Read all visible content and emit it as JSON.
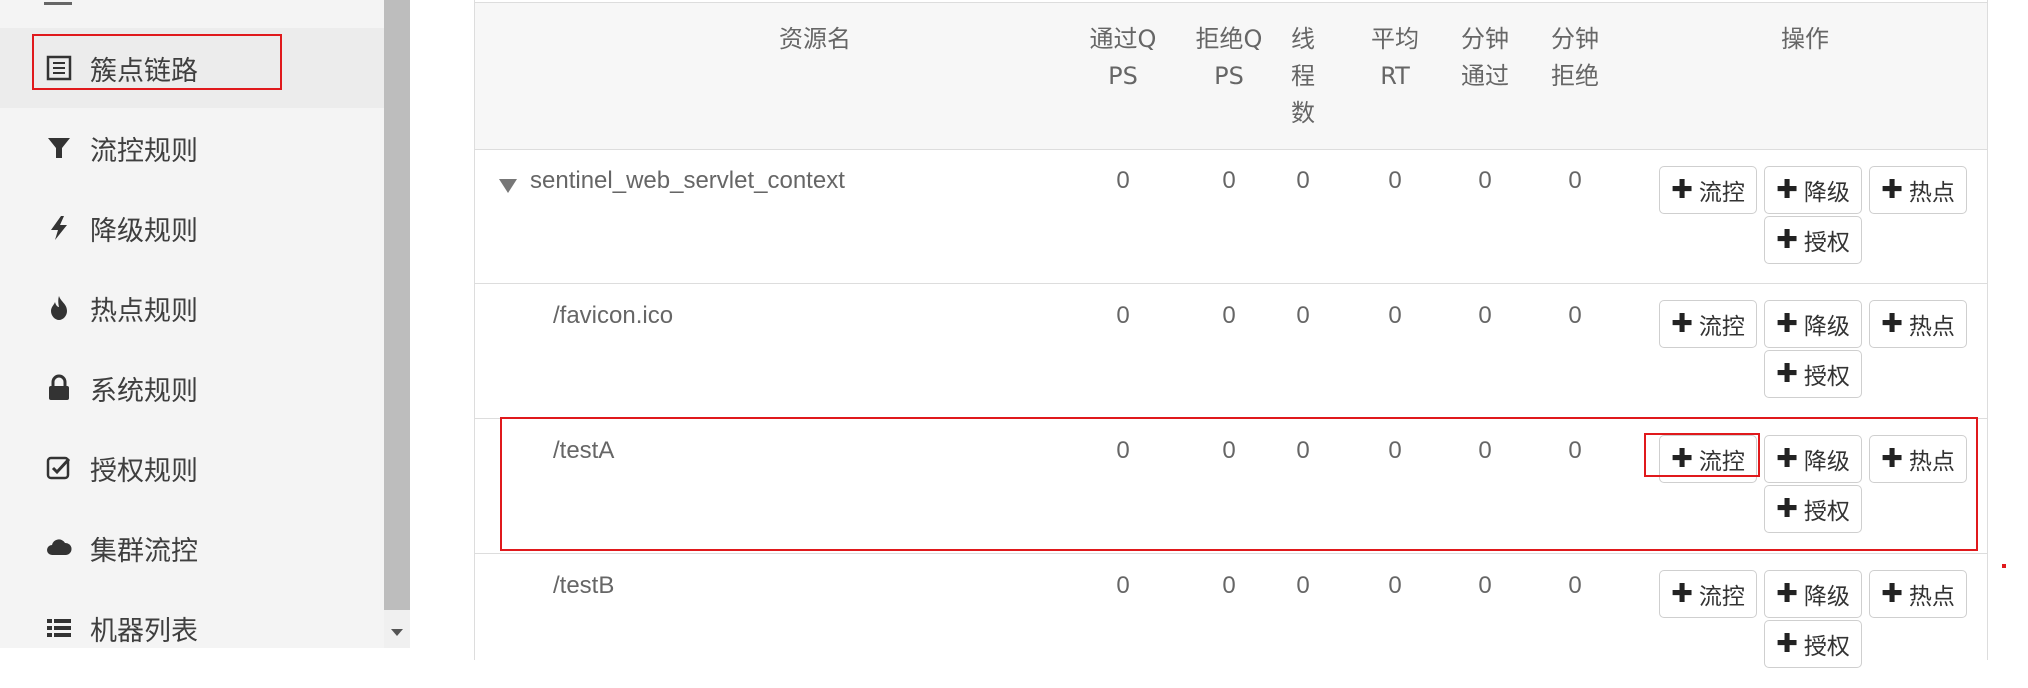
{
  "sidebar": {
    "items": [
      {
        "label": "簇点链路",
        "icon": "list-icon"
      },
      {
        "label": "流控规则",
        "icon": "filter-icon"
      },
      {
        "label": "降级规则",
        "icon": "bolt-icon"
      },
      {
        "label": "热点规则",
        "icon": "fire-icon"
      },
      {
        "label": "系统规则",
        "icon": "lock-icon"
      },
      {
        "label": "授权规则",
        "icon": "check-square-icon"
      },
      {
        "label": "集群流控",
        "icon": "cloud-icon"
      },
      {
        "label": "机器列表",
        "icon": "list-bullet-icon"
      }
    ]
  },
  "table": {
    "headers": {
      "resource": "资源名",
      "pass_qps": "通过Q\nPS",
      "block_qps": "拒绝Q\nPS",
      "threads": "线\n程\n数",
      "avg_rt": "平均\nRT",
      "minute_pass": "分钟\n通过",
      "minute_block": "分钟\n拒绝",
      "ops": "操作"
    },
    "rows": [
      {
        "name": "sentinel_web_servlet_context",
        "pass_qps": "0",
        "block_qps": "0",
        "threads": "0",
        "avg_rt": "0",
        "minute_pass": "0",
        "minute_block": "0"
      },
      {
        "name": "/favicon.ico",
        "pass_qps": "0",
        "block_qps": "0",
        "threads": "0",
        "avg_rt": "0",
        "minute_pass": "0",
        "minute_block": "0"
      },
      {
        "name": "/testA",
        "pass_qps": "0",
        "block_qps": "0",
        "threads": "0",
        "avg_rt": "0",
        "minute_pass": "0",
        "minute_block": "0"
      },
      {
        "name": "/testB",
        "pass_qps": "0",
        "block_qps": "0",
        "threads": "0",
        "avg_rt": "0",
        "minute_pass": "0",
        "minute_block": "0"
      }
    ],
    "buttons": {
      "flow": "流控",
      "degrade": "降级",
      "hotspot": "热点",
      "auth": "授权",
      "plus": "✚"
    }
  },
  "colors": {
    "highlight": "#e0191c",
    "sidebar_bg": "#f4f4f4",
    "header_bg": "#f7f7f7"
  }
}
